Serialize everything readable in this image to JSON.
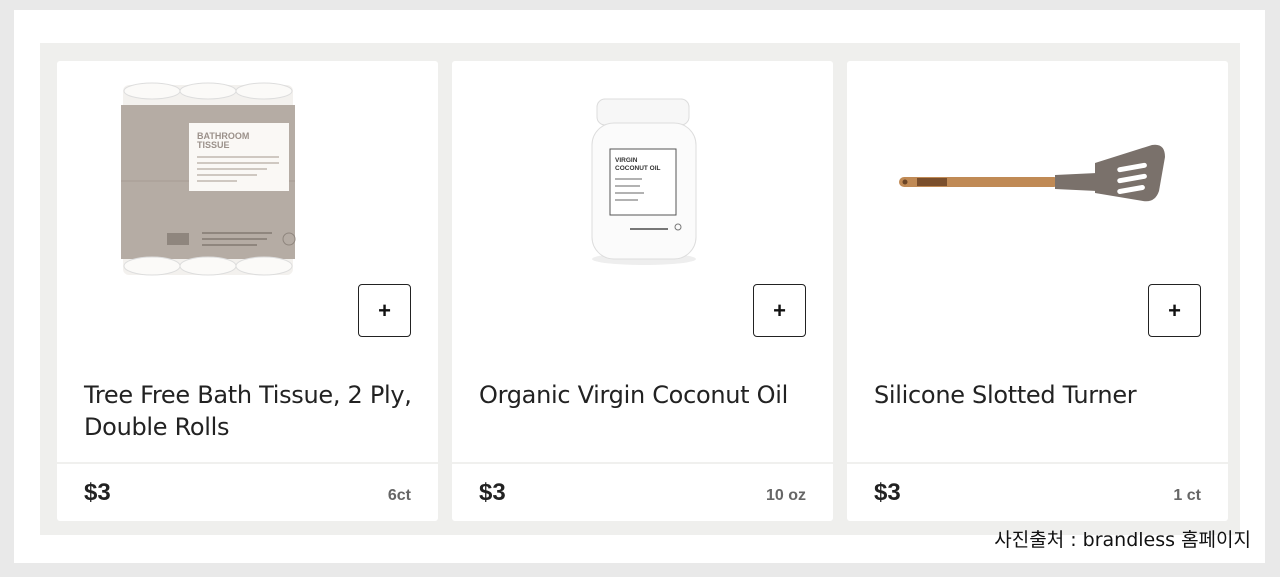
{
  "products": [
    {
      "name": "Tree Free Bath Tissue, 2 Ply, Double Rolls",
      "price": "$3",
      "unit": "6ct",
      "add_label": "+",
      "package_text": [
        "BATHROOM",
        "TISSUE"
      ]
    },
    {
      "name": "Organic Virgin Coconut Oil",
      "price": "$3",
      "unit": "10 oz",
      "add_label": "+",
      "package_text": [
        "VIRGIN",
        "COCONUT OIL"
      ]
    },
    {
      "name": "Silicone Slotted Turner",
      "price": "$3",
      "unit": "1 ct",
      "add_label": "+"
    }
  ],
  "caption": "사진출처 : brandless 홈페이지",
  "colors": {
    "panel_bg": "#efefed",
    "card_bg": "#ffffff",
    "text": "#222222",
    "unit_text": "#666666",
    "tissue_wrap": "#b5aca4",
    "spatula_silicone": "#7a716b",
    "spatula_wood": "#c08a55"
  }
}
